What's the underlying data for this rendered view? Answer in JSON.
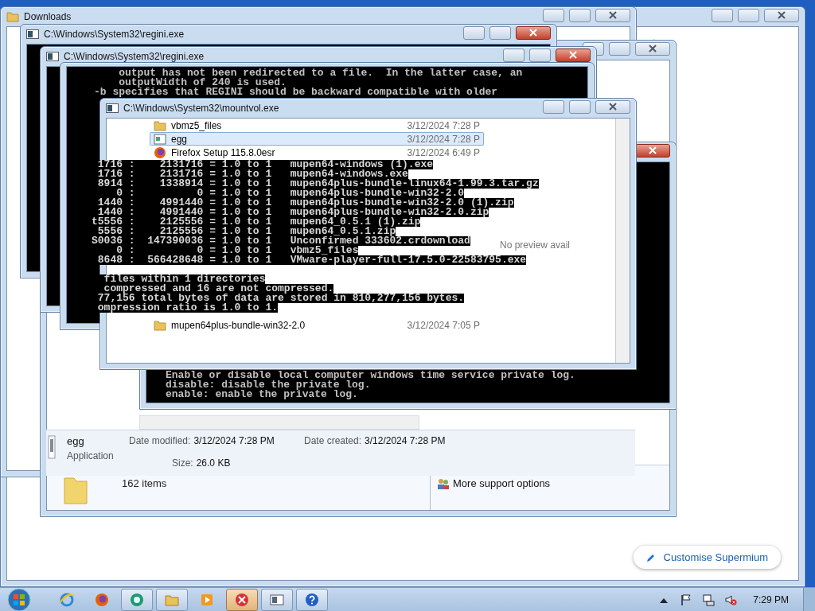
{
  "windows": [
    {
      "kind": "browser",
      "button": "Customise Supermium",
      "close_highlight": false
    },
    {
      "kind": "explorer",
      "title": "Downloads",
      "close_highlight": false
    },
    {
      "kind": "help",
      "status": "162 items",
      "link": "More support options",
      "close_highlight": false
    },
    {
      "kind": "console",
      "title": "C:\\Windows\\System32\\regini.exe",
      "close_highlight": true
    },
    {
      "kind": "console",
      "title": "C:\\Windows\\System32\\regini.exe",
      "close_highlight": true
    },
    {
      "kind": "console",
      "lines": [
        "    output has not been redirected to a file.  In the latter case, an",
        "    outputWidth of 240 is used.",
        "-b specifies that REGINI should be backward compatible with older"
      ]
    },
    {
      "kind": "filelist",
      "title": "C:\\Windows\\System32\\mountvol.exe",
      "close_highlight": false,
      "rows_top": [
        {
          "name": "vbmz5_files",
          "date": "3/12/2024 7:28 P",
          "selected": false
        },
        {
          "name": "egg",
          "date": "3/12/2024 7:28 P",
          "selected": true
        },
        {
          "name": "Firefox Setup 115.8.0esr",
          "date": "3/12/2024 6:49 P",
          "selected": false
        }
      ],
      "rows_bottom": [
        {
          "name": "mupen64plus-bundle-win32-2.0",
          "date": "3/12/2024 7:05 P",
          "selected": false
        }
      ],
      "preview": "No preview avail"
    },
    {
      "kind": "console",
      "close_highlight": true,
      "lines": [
        "Enable or disable local computer windows time service private log.",
        "disable: disable the private log.",
        "enable: enable the private log."
      ]
    }
  ],
  "details_pane": {
    "name": "egg",
    "type": "Application",
    "fields": [
      {
        "label": "Date modified:",
        "value": "3/12/2024 7:28 PM"
      },
      {
        "label": "Date created:",
        "value": "3/12/2024 7:28 PM"
      },
      {
        "label": "Size:",
        "value": "26.0 KB"
      }
    ]
  },
  "console_overlay": {
    "lines": [
      " 1716 :    2131716 = 1.0 to 1   mupen64-windows (1).exe",
      " 1716 :    2131716 = 1.0 to 1   mupen64-windows.exe",
      " 8914 :    1338914 = 1.0 to 1   mupen64plus-bundle-linux64-1.99.3.tar.gz",
      "    0 :          0 = 1.0 to 1   mupen64plus-bundle-win32-2.0",
      " 1440 :    4991440 = 1.0 to 1   mupen64plus-bundle-win32-2.0 (1).zip",
      " 1440 :    4991440 = 1.0 to 1   mupen64plus-bundle-win32-2.0.zip",
      "t5556 :    2125556 = 1.0 to 1   mupen64_0.5.1 (1).zip",
      " 5556 :    2125556 = 1.0 to 1   mupen64_0.5.1.zip",
      "S0036 :  147390036 = 1.0 to 1   Unconfirmed 333602.crdownload",
      "    0 :          0 = 1.0 to 1   vbmz5_files",
      " 8648 :  566428648 = 1.0 to 1   VMware-player-full-17.5.0-22583795.exe",
      "  files within 1 directories",
      "  compressed and 16 are not compressed.",
      " 77,156 total bytes of data are stored in 810,277,156 bytes.",
      " ompression ratio is 1.0 to 1."
    ]
  },
  "taskbar": {
    "items": [
      {
        "kind": "ie",
        "running": false,
        "selected": false
      },
      {
        "kind": "firefox",
        "running": false,
        "selected": false
      },
      {
        "kind": "chat",
        "running": true,
        "selected": false
      },
      {
        "kind": "explorer",
        "running": true,
        "selected": false
      },
      {
        "kind": "media",
        "running": false,
        "selected": false
      },
      {
        "kind": "error",
        "running": true,
        "selected": true
      },
      {
        "kind": "console",
        "running": true,
        "selected": false
      },
      {
        "kind": "help",
        "running": true,
        "selected": false
      }
    ],
    "clock": "7:29 PM"
  }
}
